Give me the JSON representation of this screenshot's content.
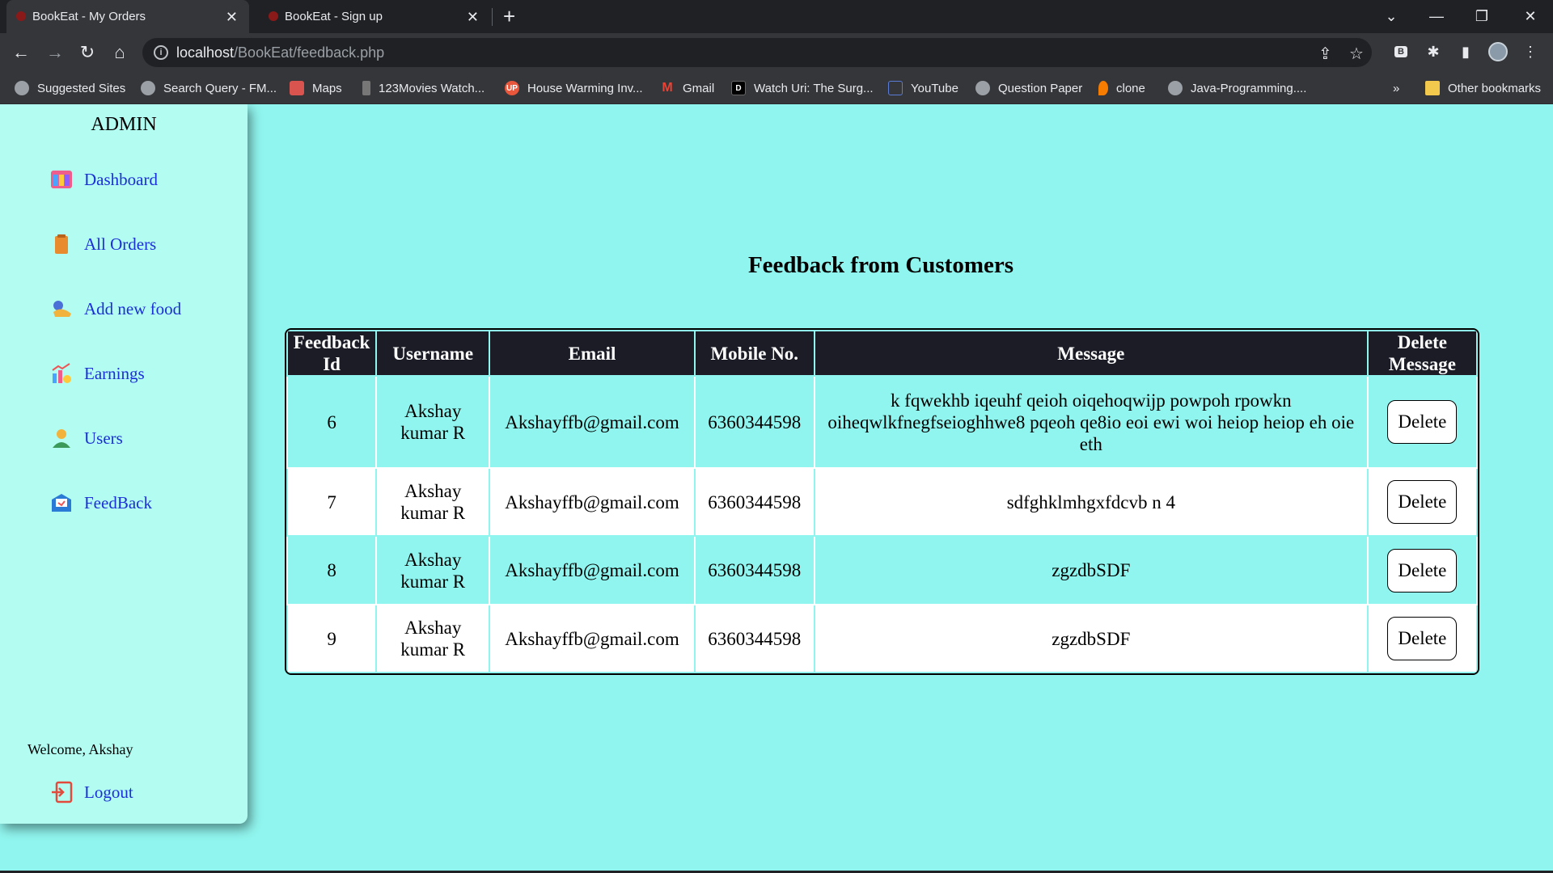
{
  "browser": {
    "tabs": [
      {
        "title": "BookEat - My Orders",
        "active": true
      },
      {
        "title": "BookEat - Sign up",
        "active": false
      }
    ],
    "url_host": "localhost",
    "url_path": "/BookEat/feedback.php",
    "bookmarks": [
      {
        "label": "Suggested Sites",
        "icon": "globe-icon"
      },
      {
        "label": "Search Query - FM...",
        "icon": "globe-icon"
      },
      {
        "label": "Maps",
        "icon": "maps-icon"
      },
      {
        "label": "123Movies Watch...",
        "icon": "movie-icon"
      },
      {
        "label": "House Warming Inv...",
        "icon": "up-icon"
      },
      {
        "label": "Gmail",
        "icon": "gmail-icon"
      },
      {
        "label": "Watch Uri: The Surg...",
        "icon": "d-icon"
      },
      {
        "label": "YouTube",
        "icon": "youtube-icon"
      },
      {
        "label": "Question Paper",
        "icon": "globe-icon"
      },
      {
        "label": "clone",
        "icon": "flame-icon"
      },
      {
        "label": "Java-Programming....",
        "icon": "globe-icon"
      }
    ],
    "more_bookmarks": "»",
    "other_bookmarks": "Other bookmarks"
  },
  "sidebar": {
    "title": "ADMIN",
    "items": [
      {
        "label": "Dashboard",
        "icon": "dashboard-icon"
      },
      {
        "label": "All Orders",
        "icon": "orders-icon"
      },
      {
        "label": "Add new food",
        "icon": "food-icon"
      },
      {
        "label": "Earnings",
        "icon": "earnings-icon"
      },
      {
        "label": "Users",
        "icon": "users-icon"
      },
      {
        "label": "FeedBack",
        "icon": "feedback-icon"
      }
    ],
    "welcome": "Welcome, Akshay",
    "logout": "Logout"
  },
  "main": {
    "title": "Feedback from Customers",
    "table": {
      "headers": [
        "Feedback Id",
        "Username",
        "Email",
        "Mobile No.",
        "Message",
        "Delete Message"
      ],
      "rows": [
        {
          "id": "6",
          "username": "Akshay kumar R",
          "email": "Akshayffb@gmail.com",
          "mobile": "6360344598",
          "message": "k fqwekhb iqeuhf qeioh oiqehoqwijp powpoh rpowkn oiheqwlkfnegfseioghhwe8 pqeoh qe8io eoi ewi woi heiop heiop eh oie eth",
          "action": "Delete"
        },
        {
          "id": "7",
          "username": "Akshay kumar R",
          "email": "Akshayffb@gmail.com",
          "mobile": "6360344598",
          "message": "sdfghklmhgxfdcvb n 4",
          "action": "Delete"
        },
        {
          "id": "8",
          "username": "Akshay kumar R",
          "email": "Akshayffb@gmail.com",
          "mobile": "6360344598",
          "message": "zgzdbSDF",
          "action": "Delete"
        },
        {
          "id": "9",
          "username": "Akshay kumar R",
          "email": "Akshayffb@gmail.com",
          "mobile": "6360344598",
          "message": "zgzdbSDF",
          "action": "Delete"
        }
      ]
    }
  },
  "colors": {
    "page_bg": "#90f5ee",
    "sidebar_bg": "#b3fcf2",
    "header_bg": "#1b1c26",
    "link": "#1a2fd6"
  }
}
